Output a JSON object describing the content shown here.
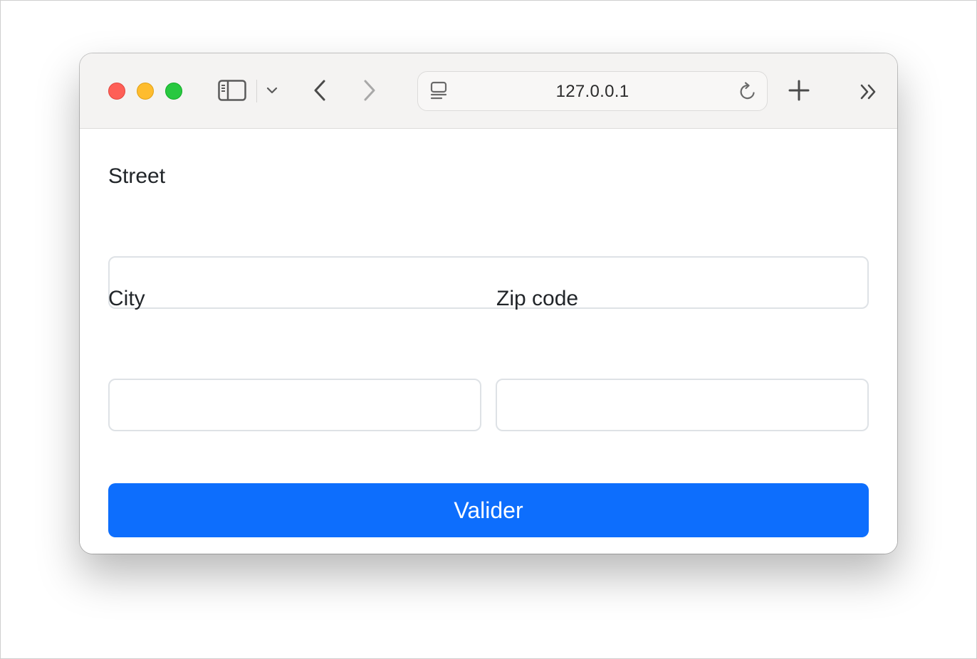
{
  "browser": {
    "url": "127.0.0.1",
    "icons": {
      "sidebar": "sidebar-icon",
      "sidebar_menu": "chevron-down-icon",
      "back": "chevron-left-icon",
      "forward": "chevron-right-icon",
      "page": "page-menu-icon",
      "reload": "reload-icon",
      "new_tab": "plus-icon",
      "more": "double-chevron-right-icon"
    },
    "traffic_lights": {
      "close": "#fe5f57",
      "minimize": "#febc2e",
      "zoom": "#28c840"
    }
  },
  "form": {
    "street": {
      "label": "Street",
      "value": "",
      "placeholder": ""
    },
    "city": {
      "label": "City",
      "value": "",
      "placeholder": ""
    },
    "zip": {
      "label": "Zip code",
      "value": "",
      "placeholder": ""
    },
    "submit_label": "Valider",
    "submit_color": "#0d6efd"
  },
  "debug_toolbar": {
    "icon": "symfony-logo-icon"
  }
}
